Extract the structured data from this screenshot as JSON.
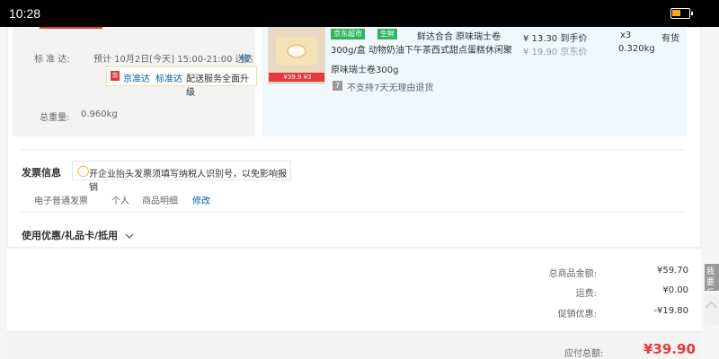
{
  "status_bar": {
    "time": "10:28",
    "battery_level": 0.5
  },
  "shipping": {
    "label": "标 准 达:",
    "time_text": "预计 10月2日[今天] 15:00-21:00 送达",
    "edit": "修改",
    "service_icon": "京",
    "service_name_1": "京准达",
    "service_name_2": "标准达",
    "service_upgrade": "配送服务全面升级",
    "weight_label": "总重量:",
    "weight_value": "0.960kg"
  },
  "product": {
    "image_price_tag": "¥39.9 ¥3",
    "badge_jd": "京东超市",
    "badge_fresh": "生鲜",
    "title_line1": "鲜达合合 原味瑞士卷",
    "title_line2": "300g/盒 动物奶油下午茶西式甜点蛋糕休闲聚",
    "spec": "原味瑞士卷300g",
    "return_note": "不支持7天无理由退货",
    "price": "¥ 13.30 到手价",
    "original_price": "¥ 19.90 京东价",
    "quantity": "x3",
    "weight": "0.320kg",
    "stock": "有货"
  },
  "invoice": {
    "title": "发票信息",
    "tip": "开企业抬头发票须填写纳税人识别号，以免影响报销",
    "type": "电子普通发票",
    "holder": "个人",
    "content": "商品明细",
    "edit": "修改"
  },
  "coupons": {
    "label": "使用优惠/礼品卡/抵用"
  },
  "summary": {
    "goods_total_label": "总商品金额:",
    "goods_total_value": "¥59.70",
    "shipping_label": "运费:",
    "shipping_value": "¥0.00",
    "discount_label": "促销优惠:",
    "discount_value": "-¥19.80"
  },
  "total": {
    "label": "应付总额:",
    "value": "¥39.90"
  },
  "side": {
    "feedback": "我要反馈"
  },
  "colors": {
    "accent": "#e4393c",
    "link": "#005ea7",
    "fresh": "#2eb45f"
  },
  "icons": [
    "battery-icon",
    "lightbulb-icon",
    "return-policy-icon",
    "chevron-down-icon",
    "back-to-top-icon"
  ]
}
